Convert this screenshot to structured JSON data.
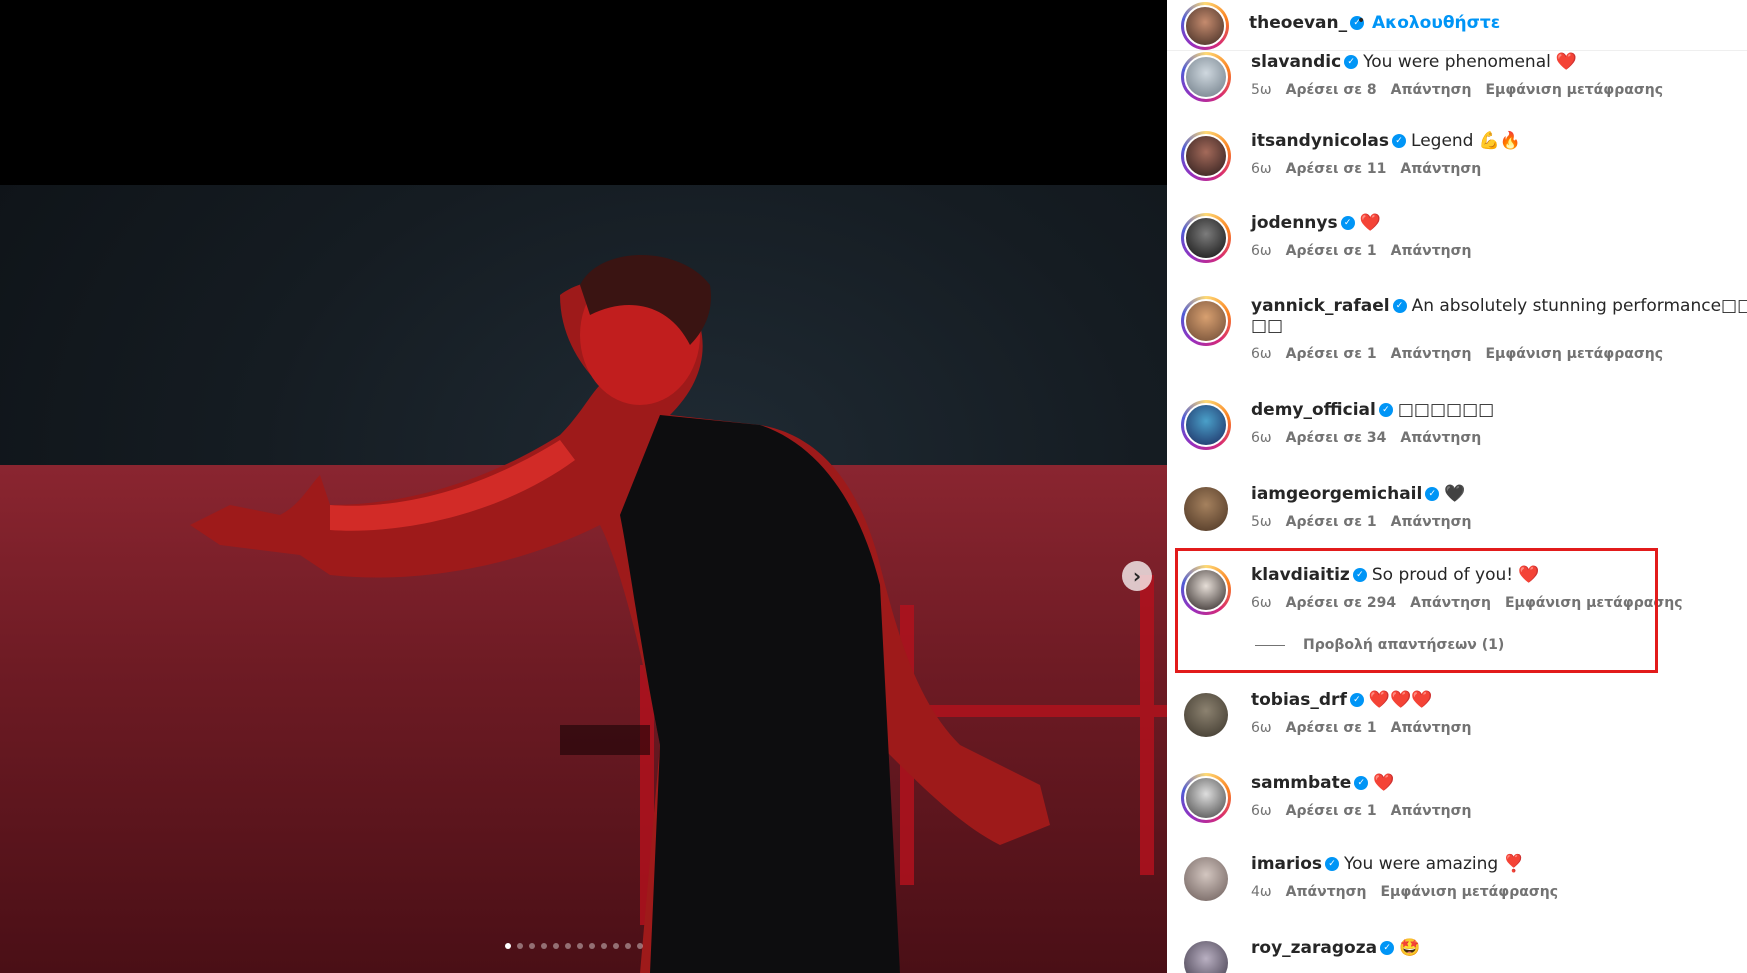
{
  "post": {
    "carousel_dots": 12,
    "active_dot": 0,
    "next_symbol": "›"
  },
  "header": {
    "username": "theoevan_",
    "verified_symbol": "✓",
    "bullet": "•",
    "follow_label": "Ακολουθήστε"
  },
  "comments": [
    {
      "username": "slavandic",
      "text": "You were phenomenal",
      "emoji": "❤️",
      "time": "5ω",
      "likes": "Αρέσει σε 8",
      "reply": "Απάντηση",
      "translate": "Εμφάνιση μετάφρασης"
    },
    {
      "username": "itsandynicolas",
      "text": "Legend",
      "emoji": "💪🔥",
      "time": "6ω",
      "likes": "Αρέσει σε 11",
      "reply": "Απάντηση",
      "translate": ""
    },
    {
      "username": "jodennys",
      "text": "",
      "emoji": "❤️",
      "time": "6ω",
      "likes": "Αρέσει σε 1",
      "reply": "Απάντηση",
      "translate": ""
    },
    {
      "username": "yannick_rafael",
      "text": "An absolutely stunning performance□□□□□",
      "text2": "□□",
      "emoji": "",
      "time": "6ω",
      "likes": "Αρέσει σε 1",
      "reply": "Απάντηση",
      "translate": "Εμφάνιση μετάφρασης"
    },
    {
      "username": "demy_official",
      "text": "□□□□□□",
      "emoji": "",
      "time": "6ω",
      "likes": "Αρέσει σε 34",
      "reply": "Απάντηση",
      "translate": ""
    },
    {
      "username": "iamgeorgemichail",
      "text": "",
      "emoji": "🖤",
      "time": "5ω",
      "likes": "Αρέσει σε 1",
      "reply": "Απάντηση",
      "translate": ""
    },
    {
      "username": "klavdiaitiz",
      "text": "So proud of you!",
      "emoji": "❤️",
      "time": "6ω",
      "likes": "Αρέσει σε 294",
      "reply": "Απάντηση",
      "translate": "Εμφάνιση μετάφρασης",
      "view_replies": "Προβολή απαντήσεων (1)"
    },
    {
      "username": "tobias_drf",
      "text": "",
      "emoji": "❤️❤️❤️",
      "time": "6ω",
      "likes": "Αρέσει σε 1",
      "reply": "Απάντηση",
      "translate": ""
    },
    {
      "username": "sammbate",
      "text": "",
      "emoji": "❤️",
      "time": "6ω",
      "likes": "Αρέσει σε 1",
      "reply": "Απάντηση",
      "translate": ""
    },
    {
      "username": "imarios",
      "text": "You were amazing",
      "emoji": "❣️",
      "time": "4ω",
      "likes": "",
      "reply": "Απάντηση",
      "translate": "Εμφάνιση μετάφρασης"
    },
    {
      "username": "roy_zaragoza",
      "text": "",
      "emoji": "🤩",
      "time": "",
      "likes": "",
      "reply": "",
      "translate": ""
    }
  ],
  "colors": {
    "accent": "#0095f6",
    "highlight": "#e21b1b",
    "meta_text": "#737373"
  }
}
